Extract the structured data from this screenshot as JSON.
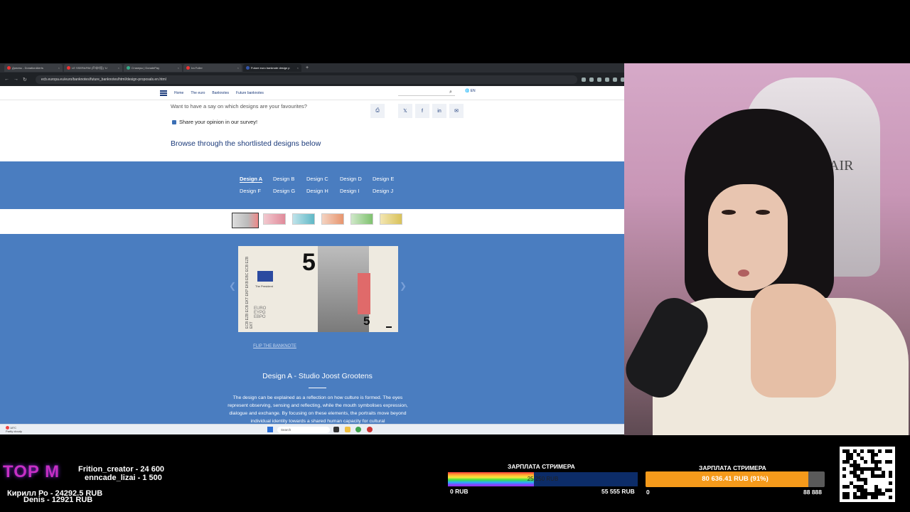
{
  "browser": {
    "tabs": [
      {
        "label": "Донаты - DonationAlerts",
        "active": false
      },
      {
        "label": "LE SSERAFIM (르세라핌) 'U",
        "active": false
      },
      {
        "label": "Стикеры | DonatePay",
        "active": false
      },
      {
        "label": "Ira Fuller",
        "active": false
      },
      {
        "label": "Future euro banknote design p",
        "active": true
      }
    ],
    "url": "ecb.europa.eu/euro/banknotes/future_banknotes/html/design-proposals.en.html"
  },
  "page": {
    "breadcrumb": [
      "Home",
      "The euro",
      "Banknotes",
      "Future banknotes"
    ],
    "language": "EN",
    "intro": "Want to have a say on which designs are your favourites?",
    "survey_link": "Share your opinion in our survey!",
    "browse_heading": "Browse through the shortlisted designs below",
    "design_tabs_row1": [
      "Design A",
      "Design B",
      "Design C",
      "Design D",
      "Design E"
    ],
    "design_tabs_row2": [
      "Design F",
      "Design G",
      "Design H",
      "Design I",
      "Design J"
    ],
    "active_design": "Design A",
    "banknote": {
      "denomination": "5",
      "signature": "The President",
      "vertical_text": "ECB EZB ECB EKT EKP EKB EBC ECB EZB EKT",
      "euro_text": [
        "EURO",
        "EYPΩ",
        "ЕВРО"
      ]
    },
    "flip_label": "FLIP THE BANKNOTE",
    "design_title": "Design A - Studio Joost Grootens",
    "description": "The design can be explained as a reflection on how culture is formed. The eyes represent observing, sensing and reflecting, while the mouth symbolises expression, dialogue and exchange. By focusing on these elements, the portraits move beyond individual identity towards a shared human capacity for cultural"
  },
  "taskbar": {
    "weather_temp": "18°C",
    "weather_desc": "Partly cloudy",
    "search_placeholder": "Search"
  },
  "overlay": {
    "top_label": "TOP M",
    "donors_right": [
      "Frition_creator - 24 600",
      "enncade_lizai - 1 500"
    ],
    "donors_left": [
      "Кирилл Ро - 24292.5 RUB",
      "Denis - 12921 RUB"
    ],
    "goal1": {
      "title": "ЗАРПЛАТА СТРИМЕРА",
      "current_text": "25 250 RUB",
      "min": "0 RUB",
      "max": "55 555 RUB",
      "progress": 0.455
    },
    "goal2": {
      "title": "ЗАРПЛАТА СТРИМЕРА",
      "current_text": "80 636.41 RUB (91%)",
      "min": "0",
      "max": "88 888",
      "progress": 0.91
    },
    "webcam_chair_text": "AIR"
  },
  "colors": {
    "ecb_blue": "#4a7dc0",
    "ecb_navy": "#1b3a7a",
    "top_m": "#c72fc4",
    "goal2_fill": "#f59a1b"
  }
}
